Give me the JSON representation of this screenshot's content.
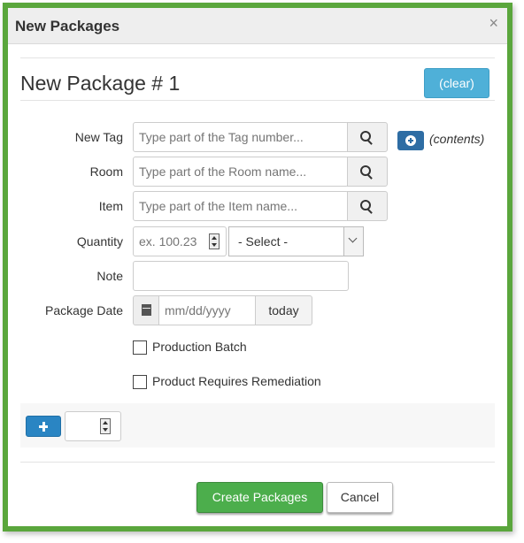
{
  "dialog": {
    "title": "New Packages",
    "close_label": "×",
    "package_heading": "New Package # 1",
    "clear_label": "(clear)"
  },
  "form": {
    "new_tag": {
      "label": "New Tag",
      "placeholder": "Type part of the Tag number..."
    },
    "room": {
      "label": "Room",
      "placeholder": "Type part of the Room name..."
    },
    "item": {
      "label": "Item",
      "placeholder": "Type part of the Item name..."
    },
    "quantity": {
      "label": "Quantity",
      "placeholder": "ex. 100.23",
      "unit_selected": "- Select -"
    },
    "note": {
      "label": "Note",
      "value": ""
    },
    "package_date": {
      "label": "Package Date",
      "placeholder": "mm/dd/yyyy",
      "today_label": "today"
    },
    "production_batch": {
      "label": "Production Batch",
      "checked": false
    },
    "requires_remediation": {
      "label": "Product Requires Remediation",
      "checked": false
    },
    "contents_label": "(contents)"
  },
  "footer": {
    "add_count_value": "",
    "create_label": "Create Packages",
    "cancel_label": "Cancel"
  },
  "colors": {
    "frame_green": "#5aa63c",
    "clear_blue": "#4fb0d8",
    "primary_blue": "#2a85c3",
    "create_green": "#4cae4c"
  },
  "icons": [
    "close-icon",
    "search-icon",
    "plus-circle-icon",
    "calendar-icon",
    "plus-icon",
    "spinner-icon",
    "chevron-down-icon"
  ]
}
